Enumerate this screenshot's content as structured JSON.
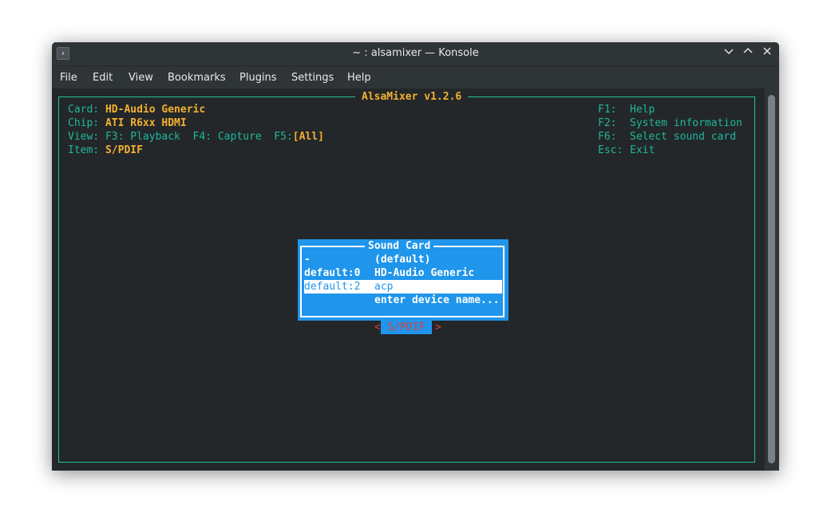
{
  "window": {
    "title": "~ : alsamixer — Konsole"
  },
  "menu": [
    "File",
    "Edit",
    "View",
    "Bookmarks",
    "Plugins",
    "Settings",
    "Help"
  ],
  "mixer": {
    "frame_title": "AlsaMixer v1.2.6",
    "card_label": "Card:",
    "card_value": "HD-Audio Generic",
    "chip_label": "Chip:",
    "chip_value": "ATI R6xx HDMI",
    "view_label": "View:",
    "view_f3": "F3: Playback",
    "view_f4": "F4: Capture",
    "view_f5": "F5:",
    "view_f5_value": "[All]",
    "item_label": "Item:",
    "item_value": "S/PDIF",
    "help": [
      {
        "key": "F1:",
        "action": "Help"
      },
      {
        "key": "F2:",
        "action": "System information"
      },
      {
        "key": "F6:",
        "action": "Select sound card"
      },
      {
        "key": "Esc:",
        "action": "Exit"
      }
    ]
  },
  "dialog": {
    "title": "Sound Card",
    "rows": [
      {
        "device": "-",
        "name": "(default)"
      },
      {
        "device": "default:0",
        "name": "HD-Audio Generic"
      },
      {
        "device": "default:2",
        "name": "acp",
        "selected": true
      },
      {
        "device": "",
        "name": "enter device name..."
      }
    ]
  },
  "control": {
    "left": "<",
    "name": "S/PDIF",
    "right": ">"
  },
  "colors": {
    "border": "#21c48d",
    "label": "#21b69a",
    "value": "#f3b130",
    "dialog_bg": "#1f95eb",
    "control_text": "#d9433a"
  }
}
